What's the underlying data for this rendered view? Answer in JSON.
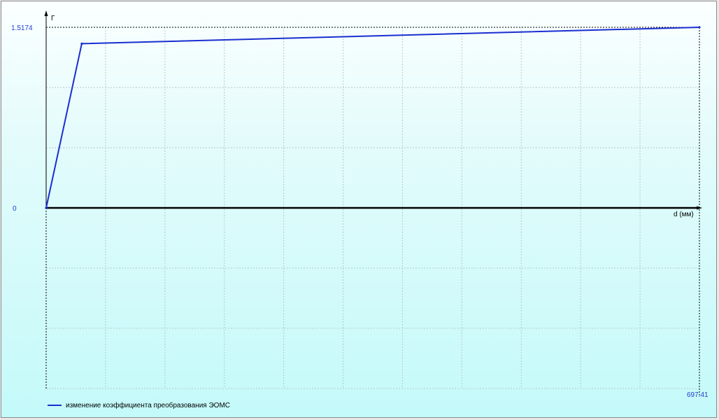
{
  "chart_data": {
    "type": "line",
    "title": "",
    "xlabel": "d (мм)",
    "ylabel": "Г",
    "xlim": [
      0,
      697.41
    ],
    "ylim": [
      -1.5174,
      1.5174
    ],
    "x_max_label": "697.41",
    "y_max_label": "1.5174",
    "y_zero_label": "0",
    "grid": true,
    "legend_position": "bottom-left",
    "series": [
      {
        "name": "изменение коэффициента преобразования ЭОМС",
        "color": "#1a2fd0",
        "x": [
          0,
          38,
          697.41
        ],
        "y": [
          0,
          1.38,
          1.5174
        ]
      }
    ]
  }
}
